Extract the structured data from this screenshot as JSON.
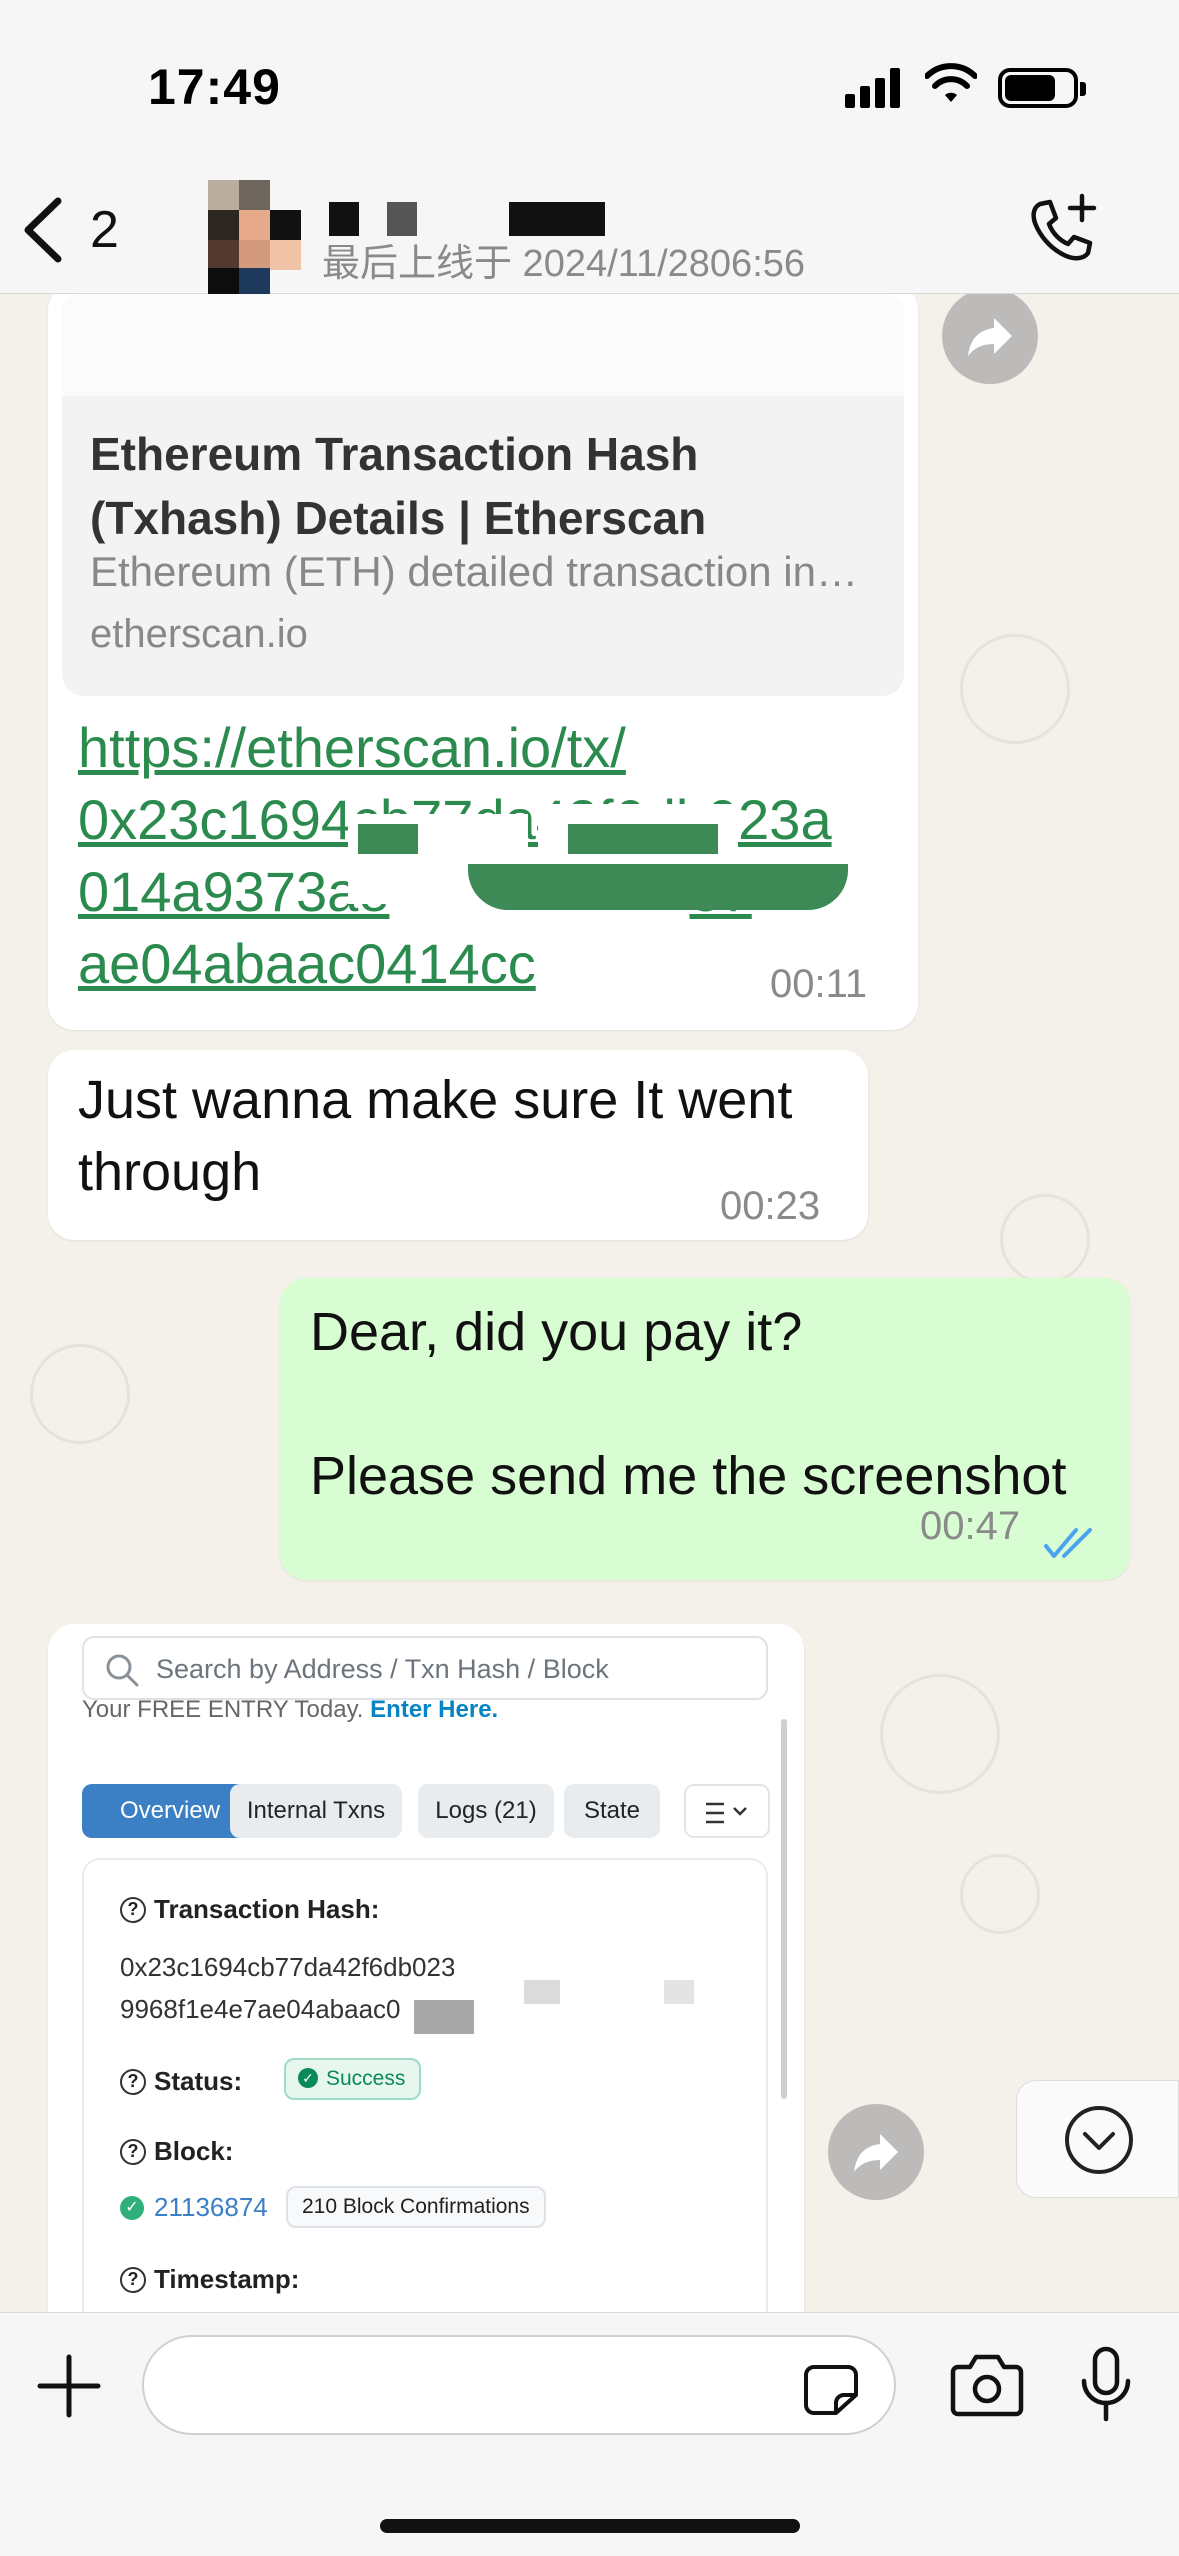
{
  "status_bar": {
    "time": "17:49"
  },
  "header": {
    "back_count": "2",
    "last_seen": "最后上线于 2024/11/2806:56"
  },
  "messages": {
    "link": {
      "preview_title": "Ethereum Transaction Hash (Txhash) Details | Etherscan",
      "preview_description": "Ethereum (ETH) detailed transaction in…",
      "preview_domain": "etherscan.io",
      "url_lines": [
        "https://etherscan.io/tx/",
        "0x23c1694cb77da42f6db023a",
        "014a9373ae",
        "ae04abaac0414cc"
      ],
      "url_line3_end": "e7",
      "time": "00:11"
    },
    "incoming_text": {
      "text": "Just wanna make sure It went through",
      "time": "00:23"
    },
    "outgoing_text": {
      "line1": "Dear, did you pay it?",
      "line2": "Please send me the screenshot",
      "time": "00:47"
    },
    "screenshot": {
      "search_placeholder": "Search by Address / Txn Hash / Block",
      "banner_text": "Your FREE ENTRY Today.",
      "banner_link": "Enter Here.",
      "tabs": [
        "Overview",
        "Internal Txns",
        "Logs (21)",
        "State"
      ],
      "tx_hash_label": "Transaction Hash:",
      "tx_hash_line1": "0x23c1694cb77da42f6db023",
      "tx_hash_line2": "9968f1e4e7ae04abaac0",
      "status_label": "Status:",
      "status_value": "Success",
      "block_label": "Block:",
      "block_number": "21136874",
      "block_confirmations": "210 Block Confirmations",
      "timestamp_label": "Timestamp:"
    }
  },
  "colors": {
    "outgoing_bubble": "#d9fdd3",
    "link_color": "#2b8a4d",
    "etherscan_blue": "#3b7fc4",
    "read_ticks": "#4aa3f0"
  },
  "icons": [
    "back-chevron-icon",
    "add-call-icon",
    "forward-icon",
    "chevron-down-icon",
    "plus-icon",
    "sticker-icon",
    "camera-icon",
    "microphone-icon"
  ]
}
